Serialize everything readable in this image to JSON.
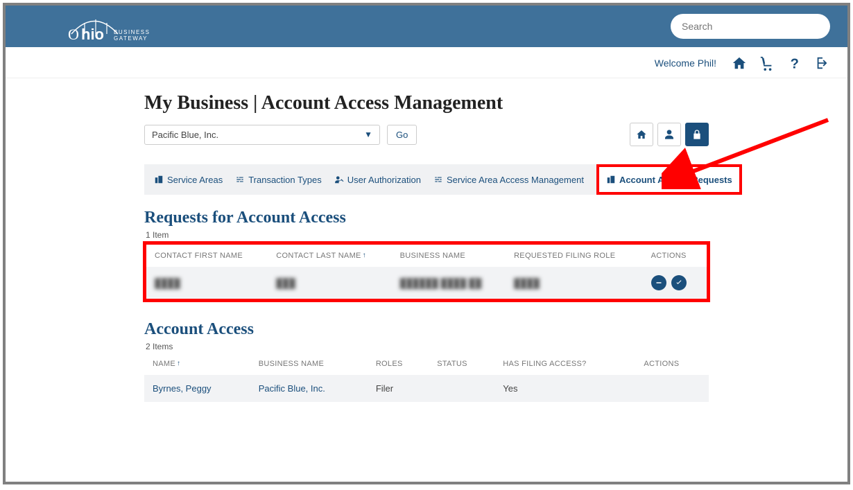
{
  "search": {
    "placeholder": "Search"
  },
  "welcome": "Welcome Phil!",
  "page": {
    "title": "My Business | Account Access Management"
  },
  "business": {
    "selected": "Pacific Blue, Inc.",
    "go_label": "Go"
  },
  "tabs": {
    "service_areas": "Service Areas",
    "transaction_types": "Transaction Types",
    "user_authorization": "User Authorization",
    "service_area_access_mgmt": "Service Area Access Management",
    "account_access_requests": "Account Access Requests"
  },
  "requests": {
    "heading": "Requests for Account Access",
    "count_text": "1 Item",
    "columns": {
      "first": "CONTACT FIRST NAME",
      "last": "CONTACT LAST NAME",
      "biz": "BUSINESS NAME",
      "role": "REQUESTED FILING ROLE",
      "actions": "ACTIONS"
    },
    "rows": [
      {
        "first": "████",
        "last": "███",
        "biz": "██████ ████ ██",
        "role": "████"
      }
    ]
  },
  "access": {
    "heading": "Account Access",
    "count_text": "2 Items",
    "columns": {
      "name": "NAME",
      "biz": "BUSINESS NAME",
      "roles": "ROLES",
      "status": "STATUS",
      "filing": "HAS FILING ACCESS?",
      "actions": "ACTIONS"
    },
    "rows": [
      {
        "name": "Byrnes, Peggy",
        "biz": "Pacific Blue, Inc.",
        "roles": "Filer",
        "status": "",
        "filing": "Yes"
      }
    ]
  }
}
